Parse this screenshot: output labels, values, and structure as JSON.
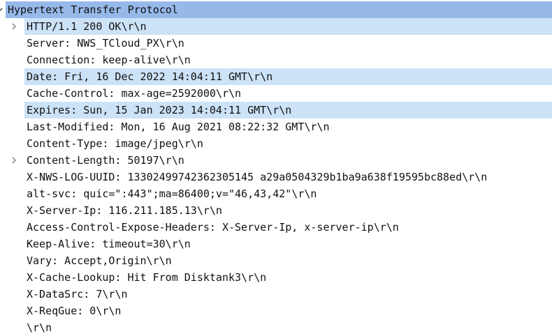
{
  "root": {
    "label": "Hypertext Transfer Protocol",
    "caret_icon": "caret-expanded-icon"
  },
  "fields": [
    {
      "text": "HTTP/1.1 200 OK\\r\\n",
      "expandable": true,
      "highlight": true
    },
    {
      "text": "Server: NWS_TCloud_PX\\r\\n",
      "expandable": false,
      "highlight": false
    },
    {
      "text": "Connection: keep-alive\\r\\n",
      "expandable": false,
      "highlight": false
    },
    {
      "text": "Date: Fri, 16 Dec 2022 14:04:11 GMT\\r\\n",
      "expandable": false,
      "highlight": true
    },
    {
      "text": "Cache-Control: max-age=2592000\\r\\n",
      "expandable": false,
      "highlight": false
    },
    {
      "text": "Expires: Sun, 15 Jan 2023 14:04:11 GMT\\r\\n",
      "expandable": false,
      "highlight": true
    },
    {
      "text": "Last-Modified: Mon, 16 Aug 2021 08:22:32 GMT\\r\\n",
      "expandable": false,
      "highlight": false
    },
    {
      "text": "Content-Type: image/jpeg\\r\\n",
      "expandable": false,
      "highlight": false
    },
    {
      "text": "Content-Length: 50197\\r\\n",
      "expandable": true,
      "highlight": false
    },
    {
      "text": "X-NWS-LOG-UUID: 13302499742362305145 a29a0504329b1ba9a638f19595bc88ed\\r\\n",
      "expandable": false,
      "highlight": false
    },
    {
      "text": "alt-svc: quic=\":443\";ma=86400;v=\"46,43,42\"\\r\\n",
      "expandable": false,
      "highlight": false
    },
    {
      "text": "X-Server-Ip: 116.211.185.13\\r\\n",
      "expandable": false,
      "highlight": false
    },
    {
      "text": "Access-Control-Expose-Headers: X-Server-Ip, x-server-ip\\r\\n",
      "expandable": false,
      "highlight": false
    },
    {
      "text": "Keep-Alive: timeout=30\\r\\n",
      "expandable": false,
      "highlight": false
    },
    {
      "text": "Vary: Accept,Origin\\r\\n",
      "expandable": false,
      "highlight": false
    },
    {
      "text": "X-Cache-Lookup: Hit From Disktank3\\r\\n",
      "expandable": false,
      "highlight": false
    },
    {
      "text": "X-DataSrc: 7\\r\\n",
      "expandable": false,
      "highlight": false
    },
    {
      "text": "X-ReqGue: 0\\r\\n",
      "expandable": false,
      "highlight": false
    },
    {
      "text": "\\r\\n",
      "expandable": false,
      "highlight": false
    }
  ],
  "colors": {
    "selected_row": "#97b9ea",
    "highlighted_row": "#cce2f7"
  }
}
